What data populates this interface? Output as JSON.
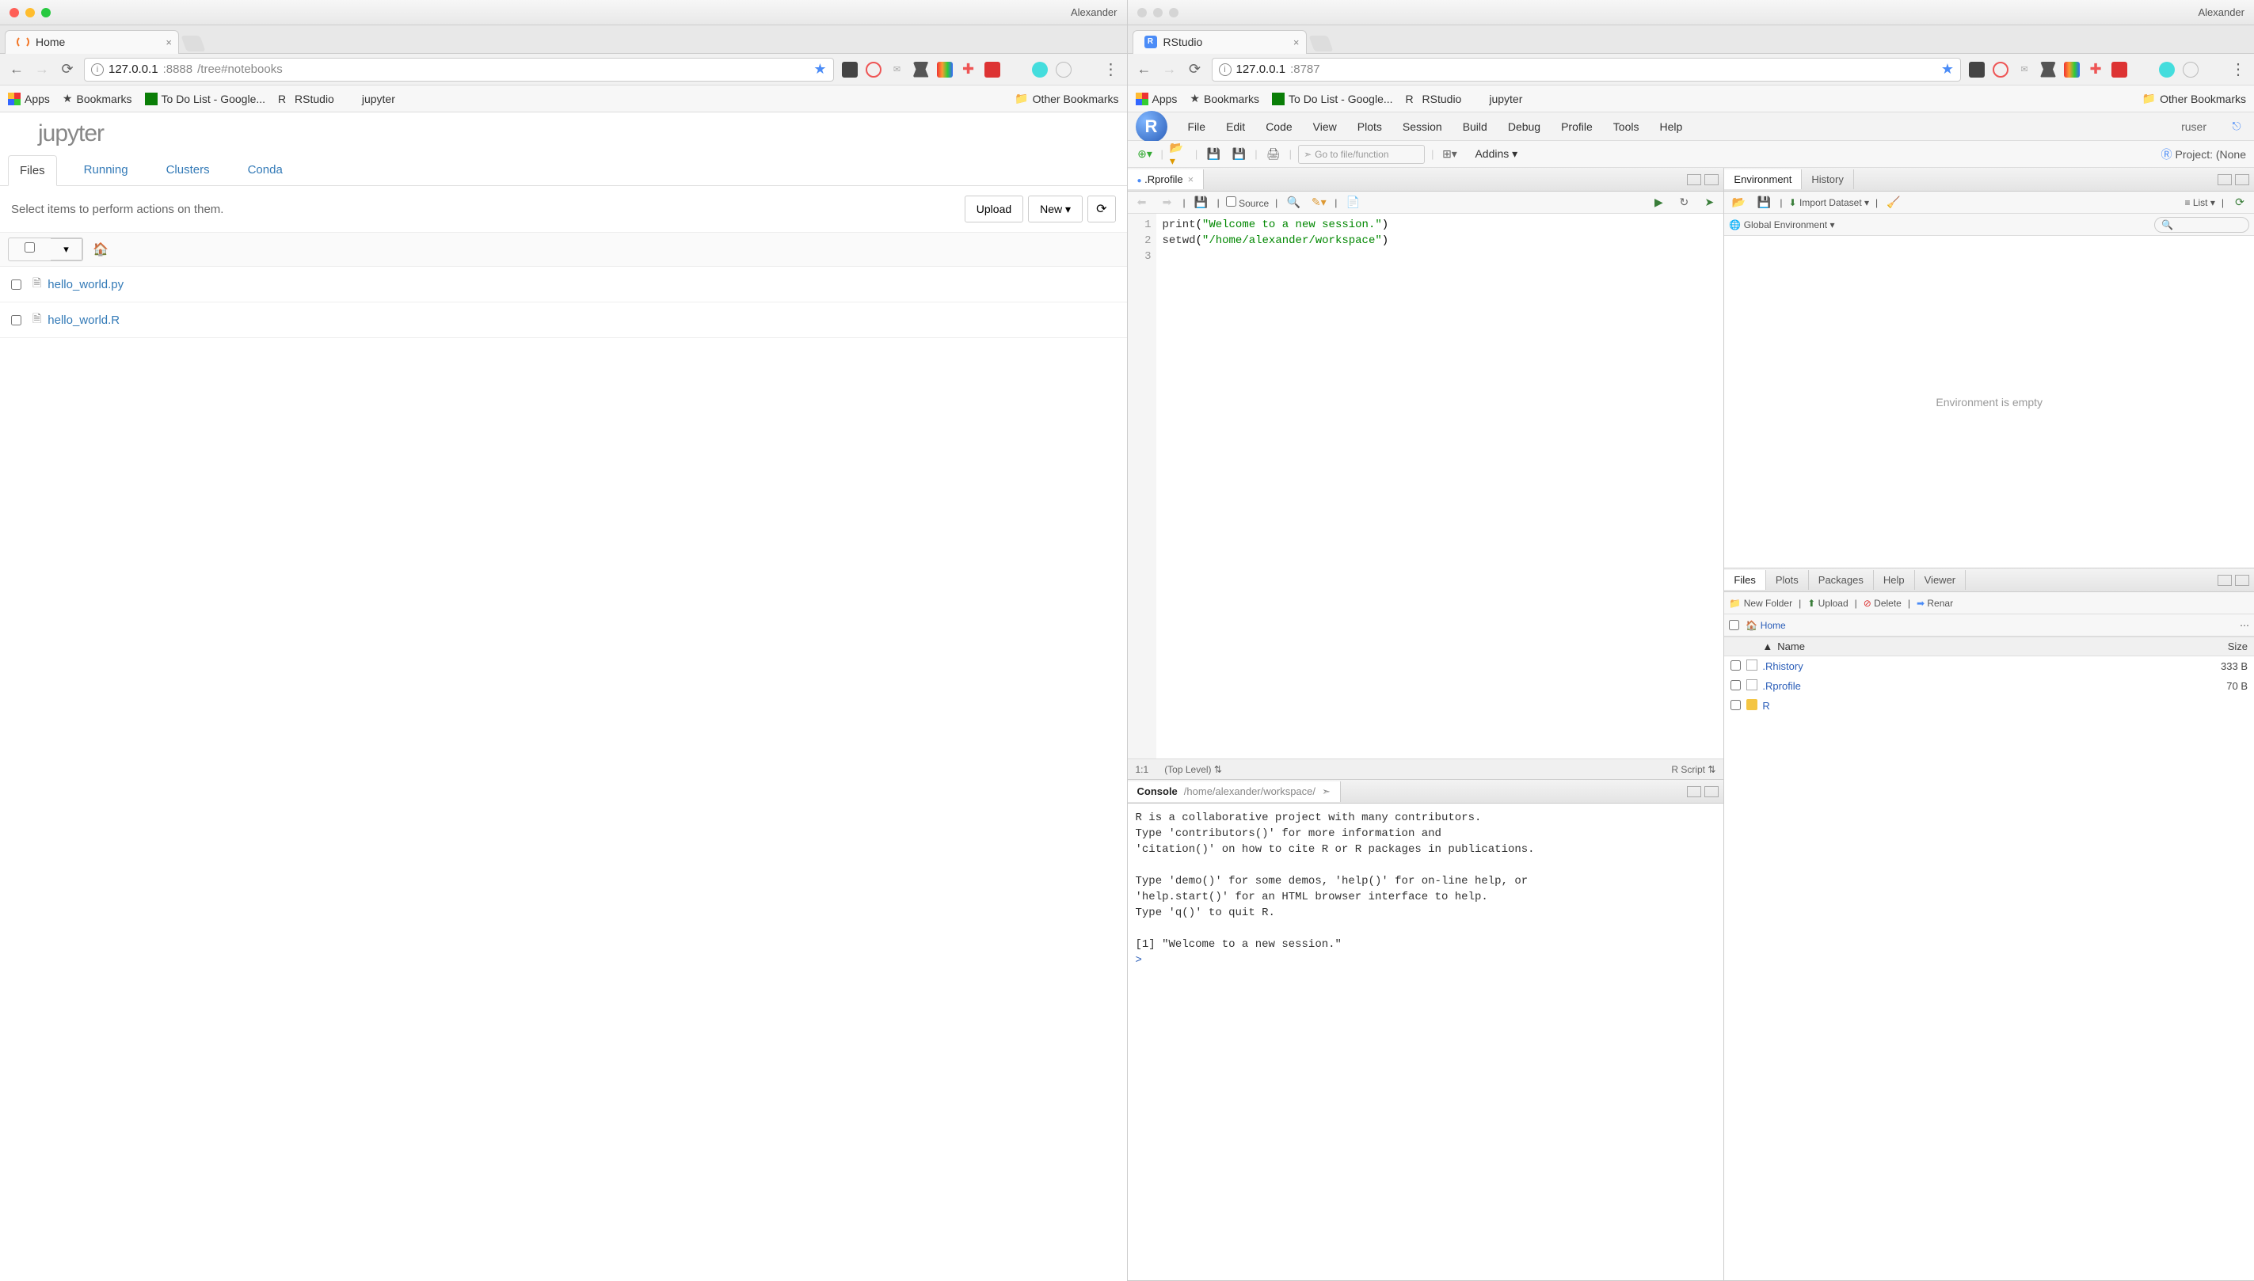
{
  "left": {
    "account": "Alexander",
    "tab_title": "Home",
    "url_host": "127.0.0.1",
    "url_port": ":8888",
    "url_path": "/tree#notebooks",
    "bookmarks": {
      "apps": "Apps",
      "bookmarks": "Bookmarks",
      "todo": "To Do List - Google...",
      "rstudio": "RStudio",
      "jupyter": "jupyter",
      "other": "Other Bookmarks"
    },
    "jupyter": {
      "logo_text": "jupyter",
      "tabs": [
        "Files",
        "Running",
        "Clusters",
        "Conda"
      ],
      "active_tab": 0,
      "hint": "Select items to perform actions on them.",
      "buttons": {
        "upload": "Upload",
        "new": "New"
      },
      "files": [
        {
          "name": "hello_world.py"
        },
        {
          "name": "hello_world.R"
        }
      ]
    }
  },
  "right": {
    "account": "Alexander",
    "tab_title": "RStudio",
    "url_host": "127.0.0.1",
    "url_port": ":8787",
    "bookmarks": {
      "apps": "Apps",
      "bookmarks": "Bookmarks",
      "todo": "To Do List - Google...",
      "rstudio": "RStudio",
      "jupyter": "jupyter",
      "other": "Other Bookmarks"
    },
    "rstudio": {
      "menu": [
        "File",
        "Edit",
        "Code",
        "View",
        "Plots",
        "Session",
        "Build",
        "Debug",
        "Profile",
        "Tools",
        "Help"
      ],
      "user": "ruser",
      "goto_placeholder": "Go to file/function",
      "addins": "Addins",
      "project": "Project: (None",
      "source": {
        "tab": ".Rprofile",
        "toolbar_src": "Source",
        "lines": [
          "print(\"Welcome to a new session.\")",
          "setwd(\"/home/alexander/workspace\")",
          ""
        ],
        "status_pos": "1:1",
        "status_scope": "(Top Level)",
        "status_lang": "R Script"
      },
      "console": {
        "title": "Console",
        "path": "/home/alexander/workspace/",
        "output": "R is a collaborative project with many contributors.\nType 'contributors()' for more information and\n'citation()' on how to cite R or R packages in publications.\n\nType 'demo()' for some demos, 'help()' for on-line help, or\n'help.start()' for an HTML browser interface to help.\nType 'q()' to quit R.\n\n[1] \"Welcome to a new session.\"",
        "prompt": ">"
      },
      "env": {
        "tabs": [
          "Environment",
          "History"
        ],
        "import": "Import Dataset",
        "list": "List",
        "scope": "Global Environment",
        "empty": "Environment is empty"
      },
      "files": {
        "tabs": [
          "Files",
          "Plots",
          "Packages",
          "Help",
          "Viewer"
        ],
        "active_tab": 0,
        "toolbar": {
          "new_folder": "New Folder",
          "upload": "Upload",
          "delete": "Delete",
          "rename": "Renar"
        },
        "breadcrumb": "Home",
        "columns": {
          "name": "Name",
          "size": "Size"
        },
        "rows": [
          {
            "name": ".Rhistory",
            "size": "333 B",
            "type": "file"
          },
          {
            "name": ".Rprofile",
            "size": "70 B",
            "type": "file"
          },
          {
            "name": "R",
            "size": "",
            "type": "folder"
          }
        ]
      }
    }
  }
}
